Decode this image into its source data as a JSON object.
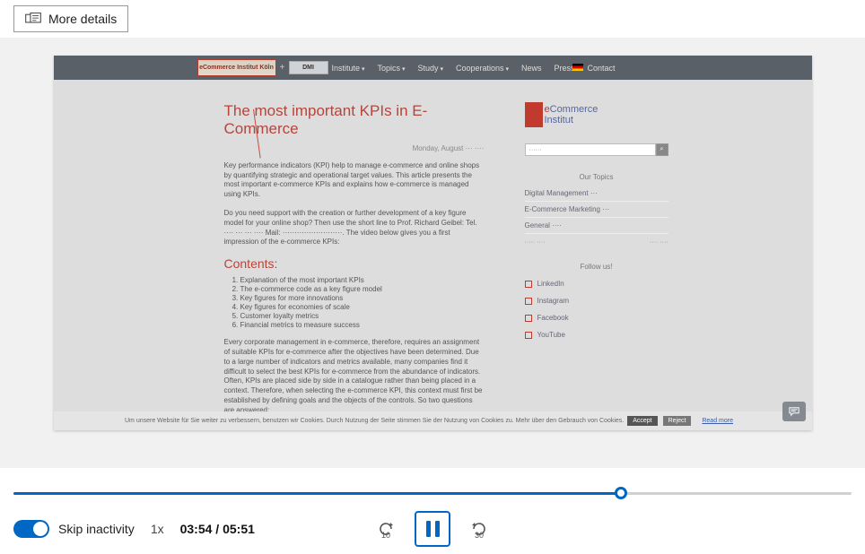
{
  "topbar": {
    "more_details": "More details"
  },
  "nav": {
    "logo1": "eCommerce Institut Köln",
    "plus": "+",
    "logo2": "DMI",
    "items": [
      "Institute",
      "Topics",
      "Study",
      "Cooperations",
      "News",
      "Press",
      "Contact"
    ],
    "caret_flags": [
      true,
      true,
      true,
      true,
      false,
      false,
      false
    ]
  },
  "article": {
    "title": "The most important KPIs in E-Commerce",
    "date": "Monday, August ··· ····",
    "p1": "Key performance indicators (KPI) help to manage e-commerce and online shops by quantifying strategic and operational target values. This article presents the most important e-commerce KPIs and explains how e-commerce is managed using KPIs.",
    "p2": "Do you need support with the creation or further development of a key figure model for your online shop? Then use the short line to Prof. Richard Geibel: Tel. ···· ··· ··· ···· Mail: ·························. The video below gives you a first impression of the e-commerce KPIs:",
    "contents_h": "Contents:",
    "contents": [
      "Explanation of the most important KPIs",
      "The e-commerce code as a key figure model",
      "Key figures for more innovations",
      "Key figures for economies of scale",
      "Customer loyalty metrics",
      "Financial metrics to measure success"
    ],
    "p3": "Every corporate management in e-commerce, therefore, requires an assignment of suitable KPIs for e-commerce after the objectives have been determined. Due to a large number of indicators and metrics available, many companies find it difficult to select the best KPIs for e-commerce from the abundance of indicators. Often, KPIs are placed side by side in a catalogue rather than being placed in a context. Therefore, when selecting the e-commerce KPI, this context must first be established by defining goals and the objects of the controls. So two questions are answered:"
  },
  "sidebar": {
    "logo_top": "Commerce",
    "logo_bot": "Institut",
    "search_placeholder": "······",
    "search_btn": "⌕",
    "topics_h": "Our Topics",
    "topics": [
      "Digital Management ···",
      "E-Commerce Marketing ···",
      "General ····"
    ],
    "date_left": "····· ····",
    "date_right": "···· ····",
    "follow_h": "Follow us!",
    "follow": [
      "LinkedIn",
      "Instagram",
      "Facebook",
      "YouTube"
    ]
  },
  "cookie": {
    "text": "Um unsere Website für Sie weiter zu verbessern, benutzen wir Cookies. Durch Nutzung der Seite stimmen Sie der Nutzung von Cookies zu. Mehr über den Gebrauch von Cookies.",
    "accept": "Accept",
    "reject": "Reject",
    "read": "Read more"
  },
  "player": {
    "skip_label": "Skip inactivity",
    "speed": "1x",
    "current": "03:54",
    "sep": " / ",
    "total": "05:51",
    "progress_pct": 72.5,
    "back": "10",
    "fwd": "30"
  }
}
